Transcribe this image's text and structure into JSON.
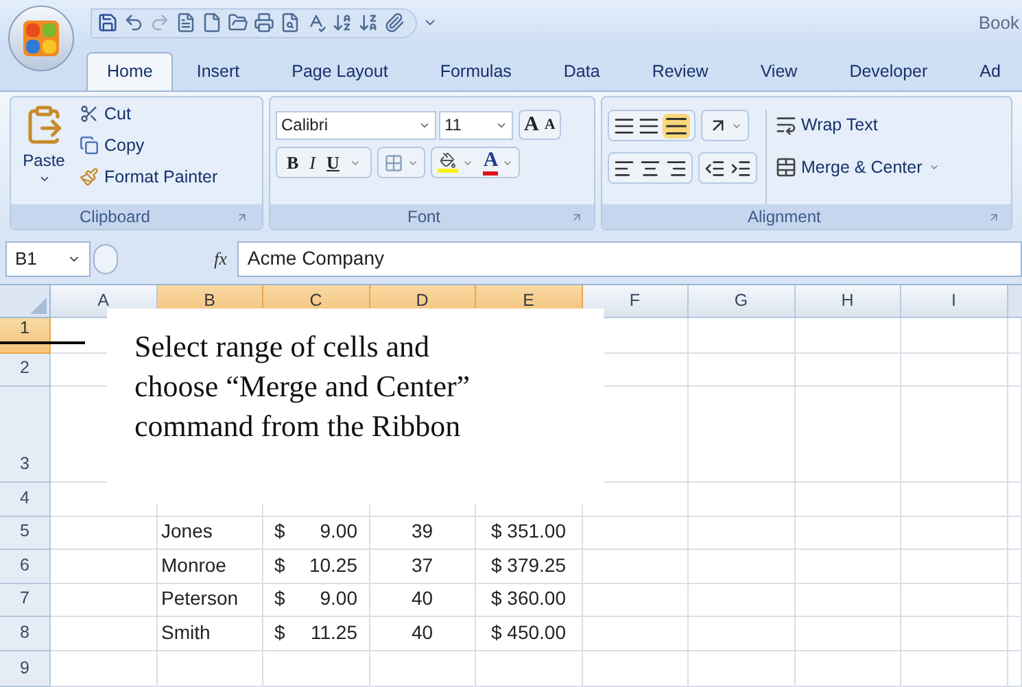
{
  "title_bar": {
    "title": "Book"
  },
  "tabs": [
    {
      "label": "Home",
      "selected": true
    },
    {
      "label": "Insert",
      "selected": false
    },
    {
      "label": "Page Layout",
      "selected": false
    },
    {
      "label": "Formulas",
      "selected": false
    },
    {
      "label": "Data",
      "selected": false
    },
    {
      "label": "Review",
      "selected": false
    },
    {
      "label": "View",
      "selected": false
    },
    {
      "label": "Developer",
      "selected": false
    },
    {
      "label": "Ad",
      "selected": false
    }
  ],
  "ribbon": {
    "clipboard": {
      "label": "Clipboard",
      "paste": "Paste",
      "cut": "Cut",
      "copy": "Copy",
      "format_painter": "Format Painter"
    },
    "font": {
      "label": "Font",
      "font_name": "Calibri",
      "font_size": "11",
      "grow": "A",
      "shrink": "A",
      "bold": "B",
      "italic": "I",
      "underline": "U",
      "font_color": "A"
    },
    "alignment": {
      "label": "Alignment",
      "wrap_text": "Wrap Text",
      "merge_center": "Merge & Center"
    }
  },
  "formula_bar": {
    "name_box": "B1",
    "function_label": "fx",
    "value": "Acme Company"
  },
  "sheet": {
    "columns": [
      {
        "label": "A",
        "selected": false
      },
      {
        "label": "B",
        "selected": true
      },
      {
        "label": "C",
        "selected": true
      },
      {
        "label": "D",
        "selected": true
      },
      {
        "label": "E",
        "selected": true
      },
      {
        "label": "F",
        "selected": false
      },
      {
        "label": "G",
        "selected": false
      },
      {
        "label": "H",
        "selected": false
      },
      {
        "label": "I",
        "selected": false
      }
    ],
    "rows": [
      {
        "label": "1",
        "selected": true
      },
      {
        "label": "2",
        "selected": false
      },
      {
        "label": "3",
        "selected": false
      },
      {
        "label": "4",
        "selected": false
      },
      {
        "label": "5",
        "selected": false,
        "name": "Jones",
        "rate_symbol": "$",
        "rate": "9.00",
        "hours": "39",
        "pay": "$ 351.00"
      },
      {
        "label": "6",
        "selected": false,
        "name": "Monroe",
        "rate_symbol": "$",
        "rate": "10.25",
        "hours": "37",
        "pay": "$ 379.25"
      },
      {
        "label": "7",
        "selected": false,
        "name": "Peterson",
        "rate_symbol": "$",
        "rate": "9.00",
        "hours": "40",
        "pay": "$ 360.00"
      },
      {
        "label": "8",
        "selected": false,
        "name": "Smith",
        "rate_symbol": "$",
        "rate": "11.25",
        "hours": "40",
        "pay": "$ 450.00"
      },
      {
        "label": "9",
        "selected": false
      }
    ]
  },
  "callout": {
    "lines": [
      "Select range of cells and",
      "choose “Merge and Center”",
      "command from the Ribbon"
    ]
  }
}
